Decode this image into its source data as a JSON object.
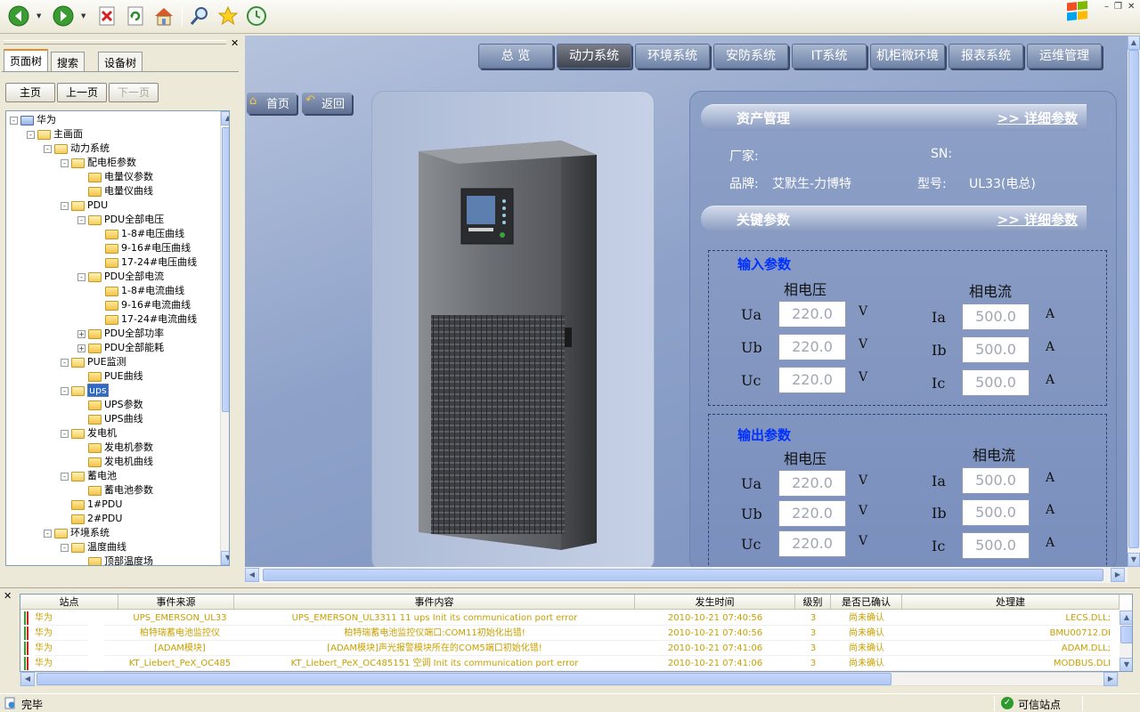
{
  "toolbar": {
    "icons": [
      "back-icon",
      "forward-icon",
      "stop-icon",
      "refresh-icon",
      "home-icon",
      "search-icon",
      "favorites-icon",
      "history-icon"
    ]
  },
  "left_panel": {
    "tabs": [
      "页面树",
      "搜索",
      "设备树"
    ],
    "nav_buttons": {
      "home": "主页",
      "prev": "上一页",
      "next": "下一页"
    },
    "tree": [
      {
        "label": "华为",
        "level": 0,
        "expander": "-",
        "icon": "computer"
      },
      {
        "label": "主画面",
        "level": 1,
        "expander": "-",
        "icon": "folder-open"
      },
      {
        "label": "动力系统",
        "level": 2,
        "expander": "-",
        "icon": "folder-open"
      },
      {
        "label": "配电柜参数",
        "level": 3,
        "expander": "-",
        "icon": "folder-open"
      },
      {
        "label": "电量仪参数",
        "level": 4,
        "expander": "",
        "icon": "folder"
      },
      {
        "label": "电量仪曲线",
        "level": 4,
        "expander": "",
        "icon": "folder"
      },
      {
        "label": "PDU",
        "level": 3,
        "expander": "-",
        "icon": "folder-open"
      },
      {
        "label": "PDU全部电压",
        "level": 4,
        "expander": "-",
        "icon": "folder-open"
      },
      {
        "label": "1-8#电压曲线",
        "level": 5,
        "expander": "",
        "icon": "folder"
      },
      {
        "label": "9-16#电压曲线",
        "level": 5,
        "expander": "",
        "icon": "folder"
      },
      {
        "label": "17-24#电压曲线",
        "level": 5,
        "expander": "",
        "icon": "folder"
      },
      {
        "label": "PDU全部电流",
        "level": 4,
        "expander": "-",
        "icon": "folder-open"
      },
      {
        "label": "1-8#电流曲线",
        "level": 5,
        "expander": "",
        "icon": "folder"
      },
      {
        "label": "9-16#电流曲线",
        "level": 5,
        "expander": "",
        "icon": "folder"
      },
      {
        "label": "17-24#电流曲线",
        "level": 5,
        "expander": "",
        "icon": "folder"
      },
      {
        "label": "PDU全部功率",
        "level": 4,
        "expander": "+",
        "icon": "folder"
      },
      {
        "label": "PDU全部能耗",
        "level": 4,
        "expander": "+",
        "icon": "folder"
      },
      {
        "label": "PUE监测",
        "level": 3,
        "expander": "-",
        "icon": "folder-open"
      },
      {
        "label": "PUE曲线",
        "level": 4,
        "expander": "",
        "icon": "folder"
      },
      {
        "label": "ups",
        "level": 3,
        "expander": "-",
        "icon": "folder-open",
        "selected": true
      },
      {
        "label": "UPS参数",
        "level": 4,
        "expander": "",
        "icon": "folder"
      },
      {
        "label": "UPS曲线",
        "level": 4,
        "expander": "",
        "icon": "folder"
      },
      {
        "label": "发电机",
        "level": 3,
        "expander": "-",
        "icon": "folder-open"
      },
      {
        "label": "发电机参数",
        "level": 4,
        "expander": "",
        "icon": "folder"
      },
      {
        "label": "发电机曲线",
        "level": 4,
        "expander": "",
        "icon": "folder"
      },
      {
        "label": "蓄电池",
        "level": 3,
        "expander": "-",
        "icon": "folder-open"
      },
      {
        "label": "蓄电池参数",
        "level": 4,
        "expander": "",
        "icon": "folder"
      },
      {
        "label": "1#PDU",
        "level": 3,
        "expander": "",
        "icon": "folder"
      },
      {
        "label": "2#PDU",
        "level": 3,
        "expander": "",
        "icon": "folder"
      },
      {
        "label": "环境系统",
        "level": 2,
        "expander": "-",
        "icon": "folder-open"
      },
      {
        "label": "温度曲线",
        "level": 3,
        "expander": "-",
        "icon": "folder-open"
      },
      {
        "label": "顶部温度场",
        "level": 4,
        "expander": "",
        "icon": "folder"
      }
    ]
  },
  "main": {
    "tabs": [
      "总  览",
      "动力系统",
      "环境系统",
      "安防系统",
      "IT系统",
      "机柜微环境",
      "报表系统",
      "运维管理"
    ],
    "active_tab": "动力系统",
    "nav": {
      "home": "首页",
      "back": "返回"
    },
    "asset": {
      "title": "资产管理",
      "detail_link": ">> 详细参数",
      "manufacturer_label": "厂家:",
      "manufacturer": "",
      "sn_label": "SN:",
      "sn": "",
      "brand_label": "品牌:",
      "brand": "艾默生-力博特",
      "model_label": "型号:",
      "model": "UL33(电总)"
    },
    "key_params": {
      "title": "关键参数",
      "detail_link": ">> 详细参数"
    },
    "input_params": {
      "title": "输入参数",
      "voltage_header": "相电压",
      "current_header": "相电流",
      "voltages": [
        {
          "label": "Ua",
          "value": "220.0",
          "unit": "V"
        },
        {
          "label": "Ub",
          "value": "220.0",
          "unit": "V"
        },
        {
          "label": "Uc",
          "value": "220.0",
          "unit": "V"
        }
      ],
      "currents": [
        {
          "label": "Ia",
          "value": "500.0",
          "unit": "A"
        },
        {
          "label": "Ib",
          "value": "500.0",
          "unit": "A"
        },
        {
          "label": "Ic",
          "value": "500.0",
          "unit": "A"
        }
      ]
    },
    "output_params": {
      "title": "输出参数",
      "voltage_header": "相电压",
      "current_header": "相电流",
      "voltages": [
        {
          "label": "Ua",
          "value": "220.0",
          "unit": "V"
        },
        {
          "label": "Ub",
          "value": "220.0",
          "unit": "V"
        },
        {
          "label": "Uc",
          "value": "220.0",
          "unit": "V"
        }
      ],
      "currents": [
        {
          "label": "Ia",
          "value": "500.0",
          "unit": "A"
        },
        {
          "label": "Ib",
          "value": "500.0",
          "unit": "A"
        },
        {
          "label": "Ic",
          "value": "500.0",
          "unit": "A"
        }
      ]
    }
  },
  "events": {
    "columns": [
      "站点",
      "事件来源",
      "事件内容",
      "发生时间",
      "级别",
      "是否已确认",
      "处理建"
    ],
    "rows": [
      [
        "华为",
        "UPS_EMERSON_UL33",
        "UPS_EMERSON_UL3311 11 ups Init its communication port error",
        "2010-10-21 07:40:56",
        "3",
        "尚未确认",
        "LECS.DLL;"
      ],
      [
        "华为",
        "柏特瑞蓄电池监控仪",
        "柏特瑞蓄电池监控仪端口:COM11初始化出错!",
        "2010-10-21 07:40:56",
        "3",
        "尚未确认",
        "BMU00712.DI"
      ],
      [
        "华为",
        "[ADAM模块]",
        "[ADAM模块]声光报警模块所在的COM5端口初始化错!",
        "2010-10-21 07:41:06",
        "3",
        "尚未确认",
        "ADAM.DLL;"
      ],
      [
        "华为",
        "KT_Liebert_PeX_OC485",
        "KT_Liebert_PeX_OC485151 空调 Init its communication port error",
        "2010-10-21 07:41:06",
        "3",
        "尚未确认",
        "MODBUS.DLI"
      ]
    ]
  },
  "status": {
    "left": "完毕",
    "right": "可信站点"
  },
  "colors": {
    "event_text": "#c8a000",
    "main_bg": "#8ea2c9",
    "group_title": "#0030ff"
  }
}
